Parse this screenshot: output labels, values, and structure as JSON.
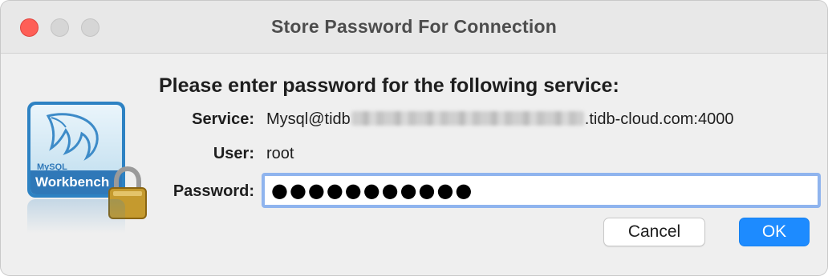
{
  "window": {
    "title": "Store Password For Connection"
  },
  "logo": {
    "brand_small": "MySQL",
    "brand_name": "Workbench",
    "icons": [
      "mysql-dolphin-icon",
      "padlock-icon"
    ]
  },
  "dialog": {
    "heading": "Please enter password for the following service:",
    "service_label": "Service:",
    "service_prefix": "Mysql@tidb",
    "service_suffix": ".tidb-cloud.com:4000",
    "user_label": "User:",
    "user_value": "root",
    "password_label": "Password:",
    "password_value": "●●●●●●●●●●●"
  },
  "buttons": {
    "cancel_label": "Cancel",
    "ok_label": "OK"
  },
  "colors": {
    "close": "#fe5f57",
    "accent": "#1d8bff",
    "focus_ring": "#8fb4ee"
  }
}
